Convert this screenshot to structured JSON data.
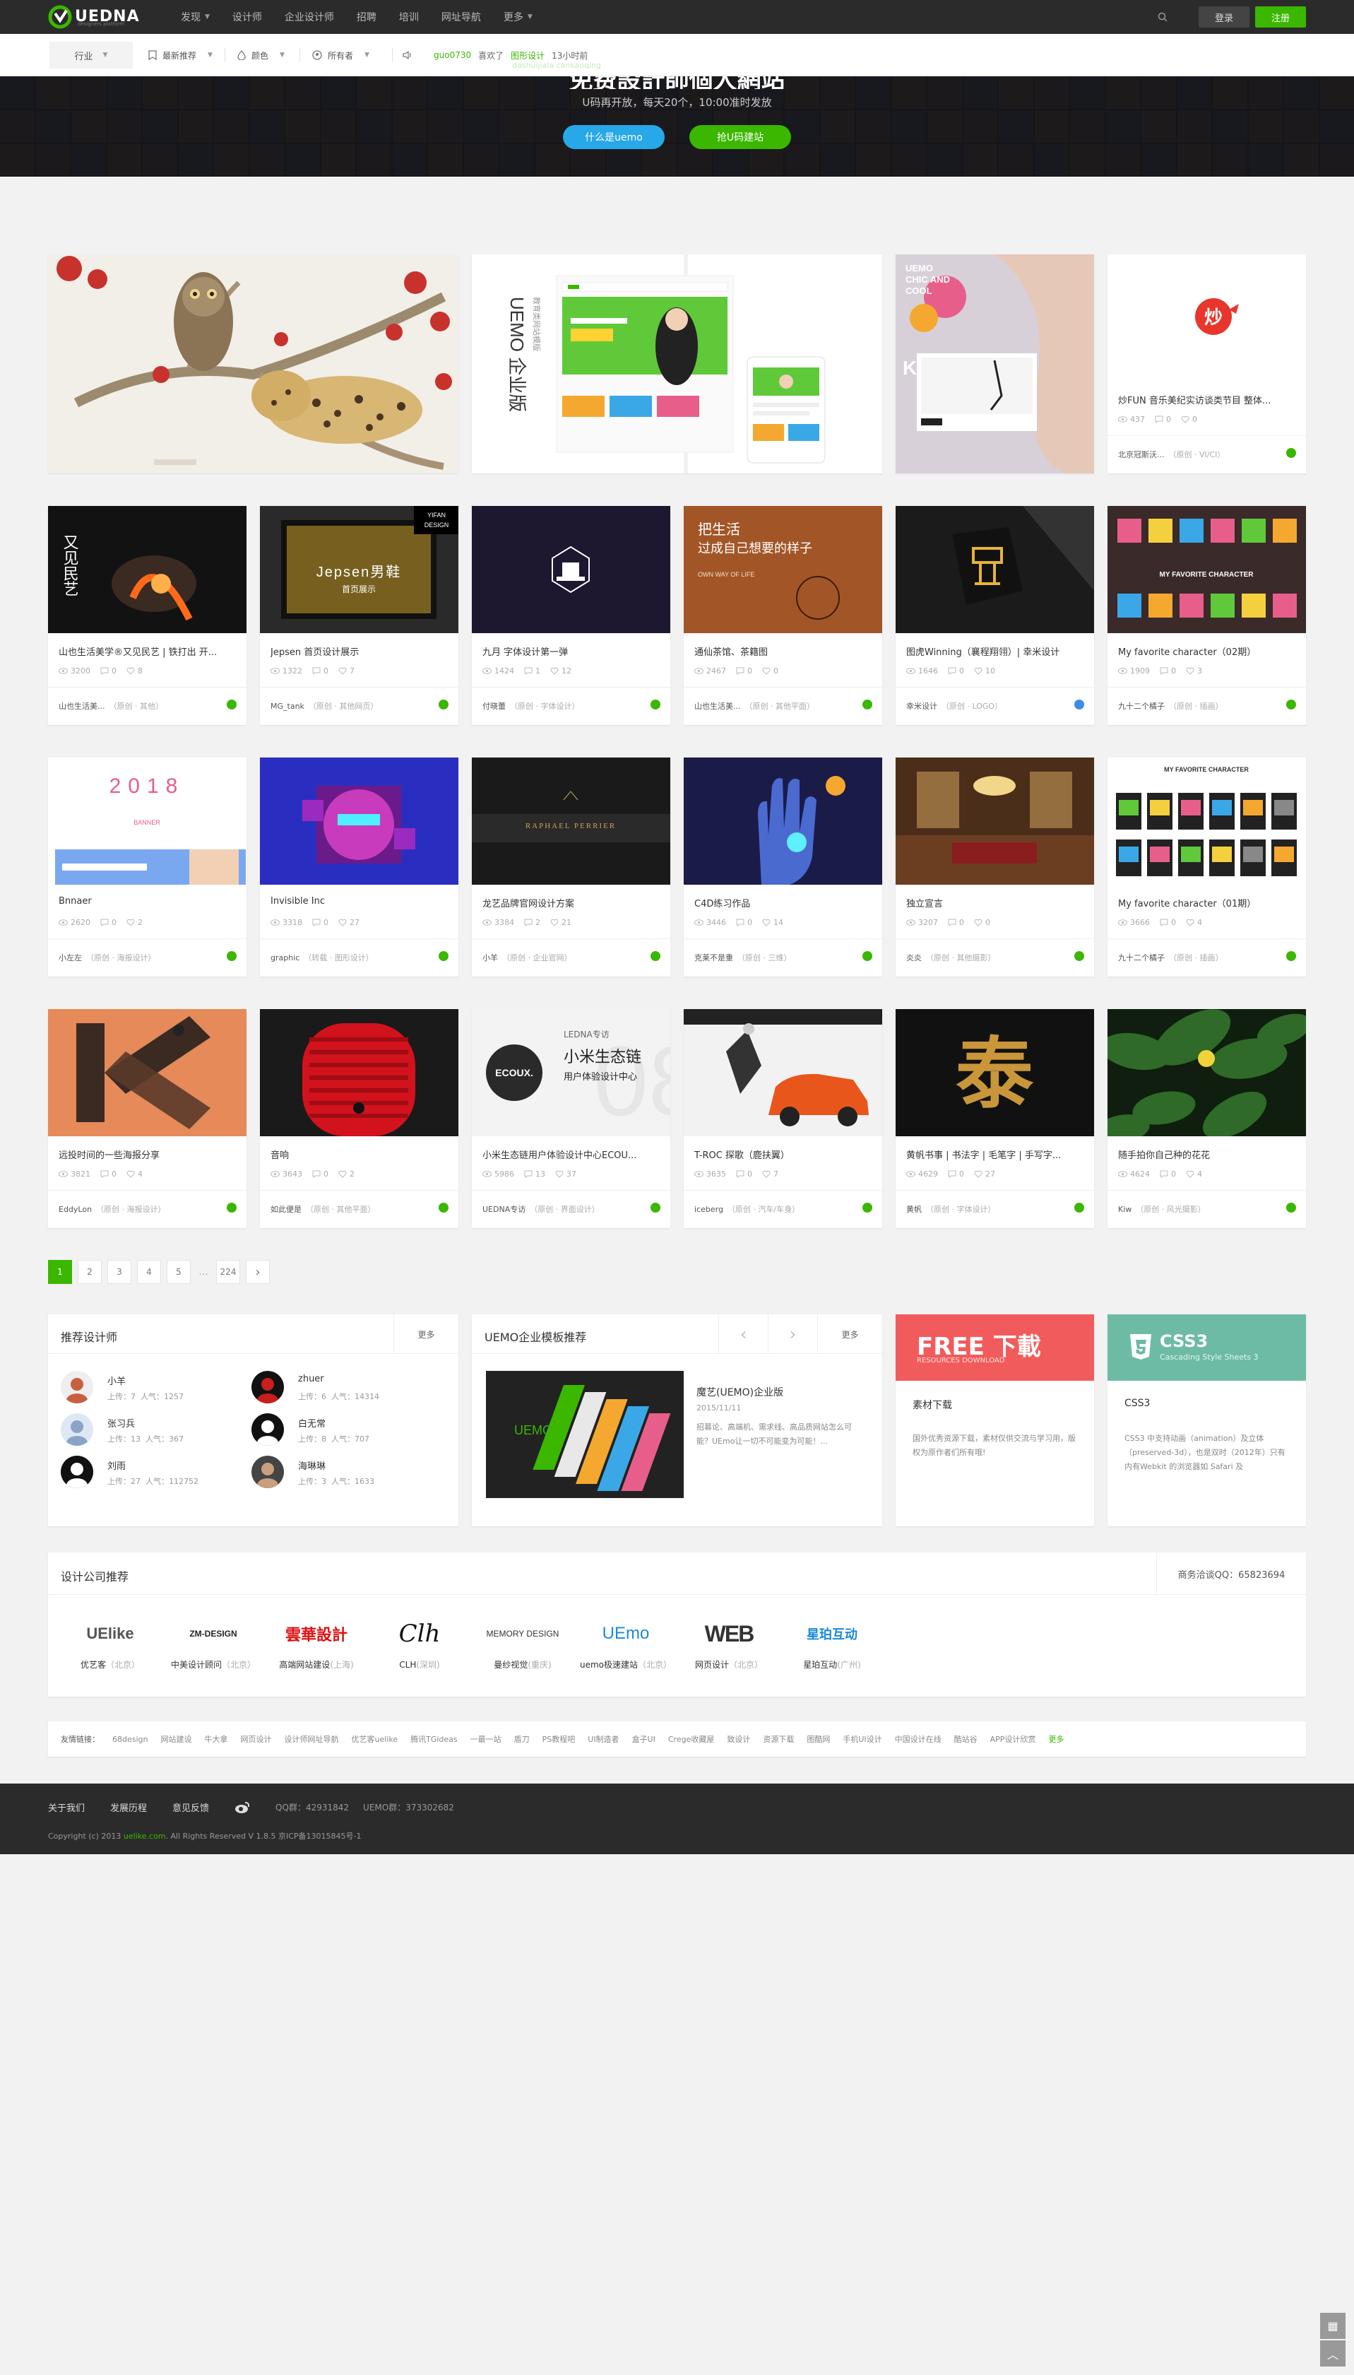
{
  "header": {
    "logo_text": "UEDNA",
    "logo_sub": "designers platform",
    "nav": [
      {
        "label": "发现",
        "caret": true
      },
      {
        "label": "设计师",
        "caret": false
      },
      {
        "label": "企业设计师",
        "caret": false
      },
      {
        "label": "招聘",
        "caret": false
      },
      {
        "label": "培训",
        "caret": false
      },
      {
        "label": "网址导航",
        "caret": false
      },
      {
        "label": "更多",
        "caret": true
      }
    ],
    "login": "登录",
    "register": "注册"
  },
  "filters": {
    "industry": "行业",
    "sort": "最新推荐",
    "color": "颜色",
    "owner": "所有者",
    "feed_user": "guo0730",
    "feed_action": "喜欢了",
    "feed_target": "图形设计",
    "feed_time": "13小时前",
    "feed_ghost": "dashuijiala cankaoqing"
  },
  "hero": {
    "title": "免费設計師個人網站",
    "subtitle": "U码再开放，每天20个，10:00准时发放",
    "btn_what": "什么是uemo",
    "btn_build": "抢U码建站"
  },
  "cards": [
    {
      "title": "炒FUN 音乐美纪实访谈类节目 整体...",
      "views": "437",
      "comments": "0",
      "likes": "0",
      "author": "北京冠斯沃...",
      "cat": "（原创 · VI/CI）",
      "badge": "green"
    },
    {
      "title": "山也生活美学®又见民艺 | 铁打出 开...",
      "views": "3200",
      "comments": "0",
      "likes": "8",
      "author": "山也生活美...",
      "cat": "（原创 · 其他）",
      "badge": "green"
    },
    {
      "title": "Jepsen 首页设计展示",
      "views": "1322",
      "comments": "0",
      "likes": "7",
      "author": "MG_tank",
      "cat": "（原创 · 其他网页）",
      "badge": "green"
    },
    {
      "title": "九月 字体设计第一弹",
      "views": "1424",
      "comments": "1",
      "likes": "12",
      "author": "付晓蕾",
      "cat": "（原创 · 字体设计）",
      "badge": "green"
    },
    {
      "title": "通仙茶馆、茶籍图",
      "views": "2467",
      "comments": "0",
      "likes": "0",
      "author": "山也生活美...",
      "cat": "（原创 · 其他平面）",
      "badge": "green"
    },
    {
      "title": "图虎Winning（襄程翔翎）| 幸米设计",
      "views": "1646",
      "comments": "0",
      "likes": "10",
      "author": "幸米设计",
      "cat": "（原创 · LOGO）",
      "badge": "blue"
    },
    {
      "title": "My favorite character（02期）",
      "views": "1909",
      "comments": "0",
      "likes": "3",
      "author": "九十二个橘子",
      "cat": "（原创 · 插画）",
      "badge": "green"
    },
    {
      "title": "Bnnaer",
      "views": "2620",
      "comments": "0",
      "likes": "2",
      "author": "小左左",
      "cat": "（原创 · 海报设计）",
      "badge": "green"
    },
    {
      "title": "Invisible Inc",
      "views": "3318",
      "comments": "0",
      "likes": "27",
      "author": "graphic",
      "cat": "（转载 · 图形设计）",
      "badge": "green"
    },
    {
      "title": "龙艺品牌官网设计方案",
      "views": "3384",
      "comments": "2",
      "likes": "21",
      "author": "小羊",
      "cat": "（原创 · 企业官网）",
      "badge": "green"
    },
    {
      "title": "C4D练习作品",
      "views": "3446",
      "comments": "0",
      "likes": "14",
      "author": "克莱不是重",
      "cat": "（原创 · 三维）",
      "badge": "green"
    },
    {
      "title": "独立宣言",
      "views": "3207",
      "comments": "0",
      "likes": "0",
      "author": "炎炎",
      "cat": "（原创 · 其他摄影）",
      "badge": "green"
    },
    {
      "title": "My favorite character（01期）",
      "views": "3666",
      "comments": "0",
      "likes": "4",
      "author": "九十二个橘子",
      "cat": "（原创 · 插画）",
      "badge": "green"
    },
    {
      "title": "远投时间的一些海报分享",
      "views": "3821",
      "comments": "0",
      "likes": "4",
      "author": "EddyLon",
      "cat": "（原创 · 海报设计）",
      "badge": "green"
    },
    {
      "title": "音响",
      "views": "3643",
      "comments": "0",
      "likes": "2",
      "author": "如此便是",
      "cat": "（原创 · 其他平面）",
      "badge": "green"
    },
    {
      "title": "小米生态链用户体验设计中心ECOU...",
      "views": "5986",
      "comments": "13",
      "likes": "37",
      "author": "UEDNA专访",
      "cat": "（原创 · 界面设计）",
      "badge": "green"
    },
    {
      "title": "T-ROC 探歌（鹿扶翼）",
      "views": "3635",
      "comments": "0",
      "likes": "7",
      "author": "iceberg",
      "cat": "（原创 · 汽车/车身）",
      "badge": "green"
    },
    {
      "title": "黄帆书事 | 书法字 | 毛笔字 | 手写字...",
      "views": "4629",
      "comments": "0",
      "likes": "27",
      "author": "黄帆",
      "cat": "（原创 · 字体设计）",
      "badge": "green"
    },
    {
      "title": "随手拍你自己种的花花",
      "views": "4624",
      "comments": "0",
      "likes": "4",
      "author": "Kiw",
      "cat": "（原创 · 风光摄影）",
      "badge": "green"
    }
  ],
  "thumbs": {
    "uemo_label": "UEMO 企业版",
    "uemo_sub": "教育类网站模版",
    "jepsen": "Jepsen男鞋",
    "jepsen_sub": "首页展示",
    "yifan": "YIFAN DESIGN",
    "mfc": "MY FAVORITE CHARACTER",
    "raphael": "RAPHAEL PERRIER",
    "ecoux": "ECOUX.",
    "ecoux_brand": "LEDNA专访",
    "ecoux_main": "小米生态链",
    "ecoux_sub": "用户体验设计中心",
    "calligraphy": "泰",
    "chao": "炒",
    "year": "2018",
    "banner": "BANNER",
    "tea1": "把生活",
    "tea2": "过成自己想要的样子",
    "tea3": "OWN WAY OF LIFE",
    "youxian": "又见民艺",
    "chic": "UEMO CHIC AND COOL"
  },
  "pagination": {
    "pages": [
      "1",
      "2",
      "3",
      "4",
      "5"
    ],
    "dots": "...",
    "last": "224",
    "next": "›"
  },
  "recommend": {
    "title": "推荐设计师",
    "more": "更多",
    "designers": [
      {
        "name": "小羊",
        "uploads": "7",
        "pop": "1257"
      },
      {
        "name": "zhuer",
        "uploads": "6",
        "pop": "14314"
      },
      {
        "name": "张习兵",
        "uploads": "13",
        "pop": "367"
      },
      {
        "name": "白无常",
        "uploads": "8",
        "pop": "707"
      },
      {
        "name": "刘雨",
        "uploads": "27",
        "pop": "112752"
      },
      {
        "name": "海琳琳",
        "uploads": "3",
        "pop": "1633"
      }
    ],
    "upload_label": "上传：",
    "pop_label": "人气："
  },
  "templates": {
    "title": "UEMO企业模板推荐",
    "more": "更多",
    "prev": "‹",
    "next": "›",
    "item_title": "魔艺(UEMO)企业版",
    "item_date": "2015/11/11",
    "item_desc": "招募论、高端机、需求线、高品质网站怎么可能？UEmo让一切不可能变为可能！..."
  },
  "ads": [
    {
      "banner_main": "FREE 下載",
      "banner_sub": "RESOURCES DOWNLOAD",
      "title": "素材下载",
      "desc": "国外优秀资源下载，素材仅供交流与学习用，版权为原作者们所有哦!"
    },
    {
      "banner_main": "CSS3",
      "banner_sub": "Cascading Style Sheets 3",
      "title": "CSS3",
      "desc": "CSS3 中支持动画（animation）及立体（preserved-3d），也是双时（2012年）只有内有Webkit 的浏览器如 Safari 及"
    }
  ],
  "companies": {
    "title": "设计公司推荐",
    "qq": "商务洽谈QQ：65823694",
    "items": [
      {
        "logo": "UElike",
        "name": "优艺客",
        "city": "（北京）"
      },
      {
        "logo": "ZM-DESIGN",
        "name": "中美设计顾问",
        "city": "（北京）"
      },
      {
        "logo": "雲華設計",
        "name": "高端网站建设",
        "city": "(上海)"
      },
      {
        "logo": "Clh",
        "name": "CLH",
        "city": "(深圳)"
      },
      {
        "logo": "MEMORY DESIGN",
        "name": "曼纱视觉",
        "city": "(重庆)"
      },
      {
        "logo": "UEmo",
        "name": "uemo极速建站",
        "city": "（北京）"
      },
      {
        "logo": "WEB",
        "name": "网页设计",
        "city": "（北京）"
      },
      {
        "logo": "星珀互动",
        "name": "星珀互动",
        "city": "(广州)"
      }
    ]
  },
  "links": {
    "head": "友情链接：",
    "items": [
      "68design",
      "网站建设",
      "牛大拿",
      "网页设计",
      "设计师网址导航",
      "优艺客uelike",
      "腾讯TGideas",
      "一最一站",
      "盾刀",
      "PS教程吧",
      "UI制造者",
      "盒子UI",
      "Crege收藏屋",
      "致设计",
      "资源下载",
      "图酷网",
      "手机UI设计",
      "中国设计在线",
      "酷站谷",
      "APP设计欣赏"
    ],
    "more": "更多"
  },
  "footer": {
    "links": [
      "关于我们",
      "发展历程",
      "意见反馈"
    ],
    "qq1": "QQ群：42931842",
    "qq2": "UEMO群：373302682",
    "copy_pre": "Copyright (c) 2013",
    "copy_site": "uelike.com",
    "copy_post": ". All Rights Reserved V 1.8.5 京ICP备13015845号-1"
  }
}
